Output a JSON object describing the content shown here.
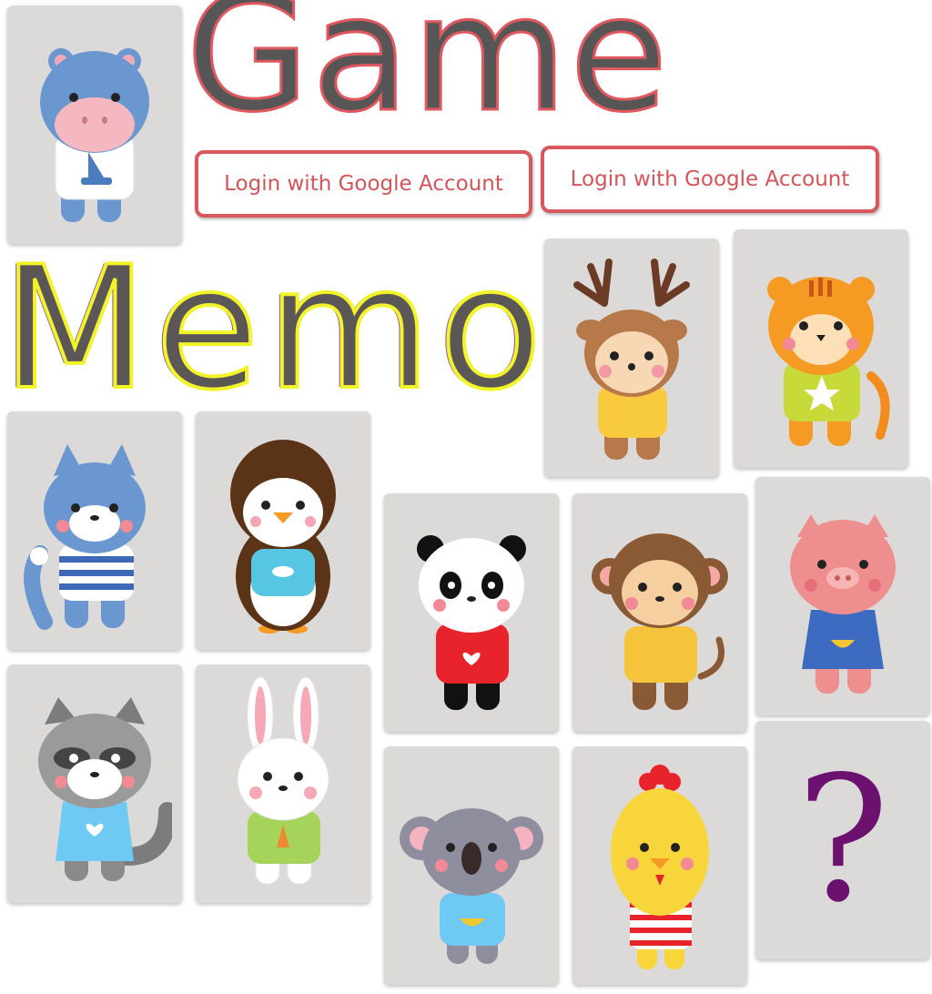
{
  "title": {
    "line1": "Game",
    "line2": "Memo"
  },
  "login": {
    "button1_label": "Login with Google Account",
    "button2_label": "Login with Google Account"
  },
  "cards": [
    {
      "animal": "hippo",
      "state": "revealed"
    },
    {
      "animal": "deer",
      "state": "revealed"
    },
    {
      "animal": "tiger",
      "state": "revealed"
    },
    {
      "animal": "cat",
      "state": "revealed"
    },
    {
      "animal": "penguin",
      "state": "revealed"
    },
    {
      "animal": "panda",
      "state": "revealed"
    },
    {
      "animal": "monkey",
      "state": "revealed"
    },
    {
      "animal": "pig",
      "state": "revealed"
    },
    {
      "animal": "raccoon",
      "state": "revealed"
    },
    {
      "animal": "rabbit",
      "state": "revealed"
    },
    {
      "animal": "koala",
      "state": "revealed"
    },
    {
      "animal": "chick",
      "state": "revealed"
    },
    {
      "animal": "unknown",
      "state": "hidden",
      "symbol": "?"
    }
  ],
  "colors": {
    "card_bg": "#dcdad9",
    "title_game_stroke": "#e0585e",
    "title_memo_stroke": "#f3f32a",
    "login_border": "#d9585e",
    "question_mark": "#6c1170"
  }
}
